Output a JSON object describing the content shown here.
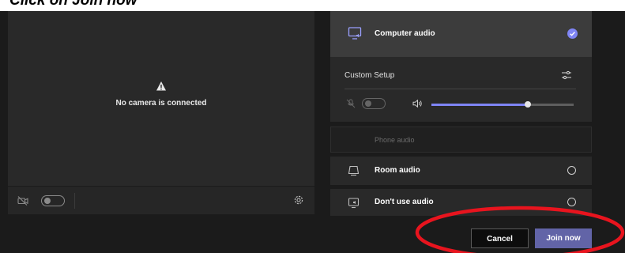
{
  "header": {
    "instruction": "Click on Join now"
  },
  "video": {
    "no_camera_text": "No camera is connected",
    "camera_toggle_on": false
  },
  "audio": {
    "computer_audio_label": "Computer audio",
    "computer_audio_selected": true,
    "custom_setup_label": "Custom Setup",
    "mic_toggle_on": false,
    "speaker_volume_fraction": 0.68,
    "phone_audio_label": "Phone audio",
    "room_audio_label": "Room audio",
    "dont_use_audio_label": "Don't use audio"
  },
  "actions": {
    "cancel_label": "Cancel",
    "join_label": "Join now"
  },
  "colors": {
    "accent": "#6264a7",
    "slider_fill": "#7f85f5",
    "check": "#7f85f5",
    "annotation": "#e8141e"
  },
  "icons": {
    "computer_audio": "monitor-speaker-icon",
    "selected": "check-circle-icon",
    "custom_setup": "sliders-icon",
    "mic": "mic-off-icon",
    "speaker": "speaker-icon",
    "camera": "camera-off-icon",
    "settings": "gear-icon",
    "warning": "warning-icon",
    "room_audio": "room-audio-icon",
    "no_audio": "no-audio-icon"
  }
}
